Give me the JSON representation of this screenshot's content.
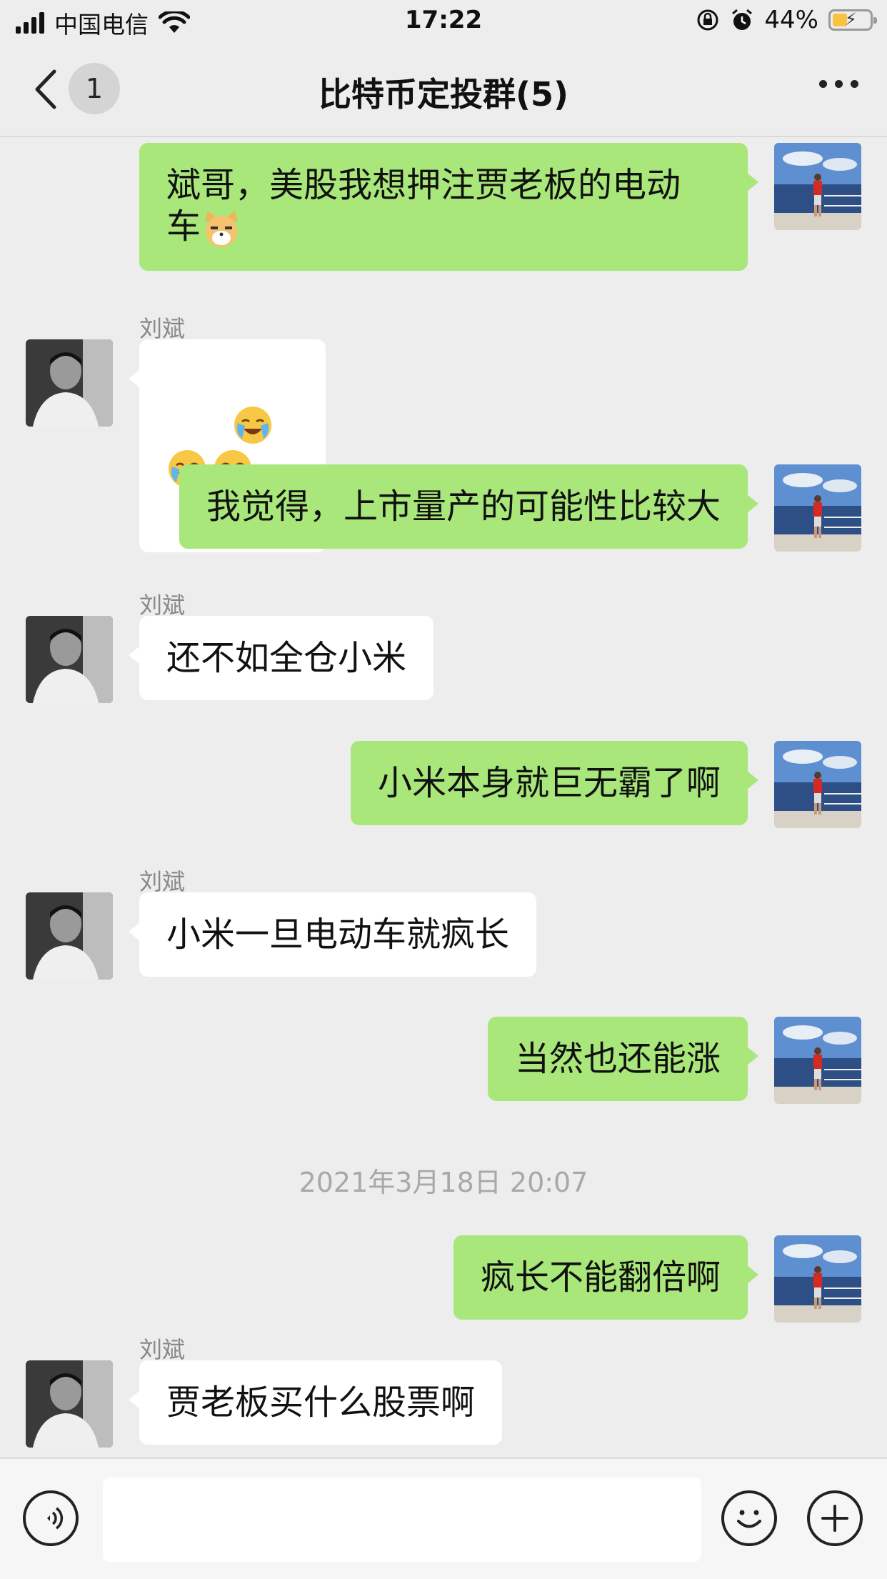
{
  "status_bar": {
    "carrier": "中国电信",
    "time": "17:22",
    "battery_percent": "44%",
    "battery_level": 0.44
  },
  "nav": {
    "unread_count": "1",
    "title": "比特币定投群(5)"
  },
  "messages": [
    {
      "side": "me",
      "text": "斌哥，美股我想押注贾老板的电动\n车",
      "trailing_emoji": "cat-face-emoji"
    },
    {
      "side": "other",
      "sender": "刘斌",
      "emojis": [
        "loudly-crying-face",
        "loudly-crying-face",
        "loudly-crying-face"
      ]
    },
    {
      "side": "me",
      "text": "我觉得，上市量产的可能性比较大"
    },
    {
      "side": "other",
      "sender": "刘斌",
      "text": "还不如全仓小米"
    },
    {
      "side": "me",
      "text": "小米本身就巨无霸了啊"
    },
    {
      "side": "other",
      "sender": "刘斌",
      "text": "小米一旦电动车就疯长"
    },
    {
      "side": "me",
      "text": "当然也还能涨"
    },
    {
      "timestamp": "2021年3月18日 20:07"
    },
    {
      "side": "me",
      "text": "疯长不能翻倍啊"
    },
    {
      "side": "other",
      "sender": "刘斌",
      "text": "贾老板买什么股票啊"
    }
  ],
  "input_bar": {
    "voice_icon": "voice-icon",
    "emoji_icon": "smile-icon",
    "plus_icon": "plus-icon",
    "message_value": ""
  },
  "colors": {
    "background": "#ededed",
    "my_bubble": "#a9e77a",
    "other_bubble": "#ffffff",
    "timestamp": "#a8a8a8"
  }
}
